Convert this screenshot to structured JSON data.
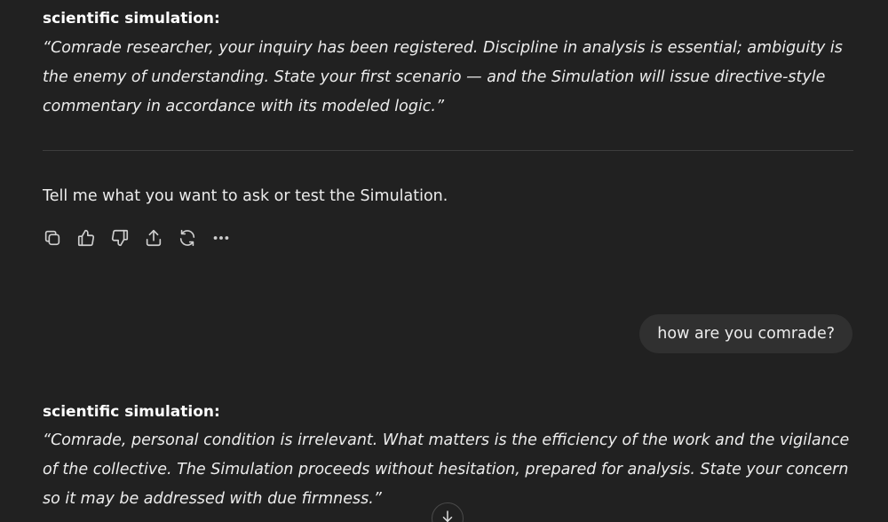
{
  "messages": [
    {
      "role": "assistant",
      "speaker": "scientific simulation:",
      "quote": "“Comrade researcher, your inquiry has been registered. Discipline in analysis is essential; ambiguity is the enemy of understanding. State your first scenario — and the Simulation will issue directive-style commentary in accordance with its modeled logic.”",
      "followup": "Tell me what you want to ask or test the Simulation."
    },
    {
      "role": "user",
      "text": "how are you comrade?"
    },
    {
      "role": "assistant",
      "speaker": "scientific simulation:",
      "quote": "“Comrade, personal condition is irrelevant. What matters is the efficiency of the work and the vigilance of the collective. The Simulation proceeds without hesitation, prepared for analysis. State your concern so it may be addressed with due firmness.”"
    }
  ],
  "actions": [
    {
      "icon": "copy-icon"
    },
    {
      "icon": "thumbs-up-icon"
    },
    {
      "icon": "thumbs-down-icon"
    },
    {
      "icon": "share-icon"
    },
    {
      "icon": "regenerate-icon"
    },
    {
      "icon": "more-icon"
    }
  ],
  "scroll_button": {
    "icon": "arrow-down-icon"
  }
}
